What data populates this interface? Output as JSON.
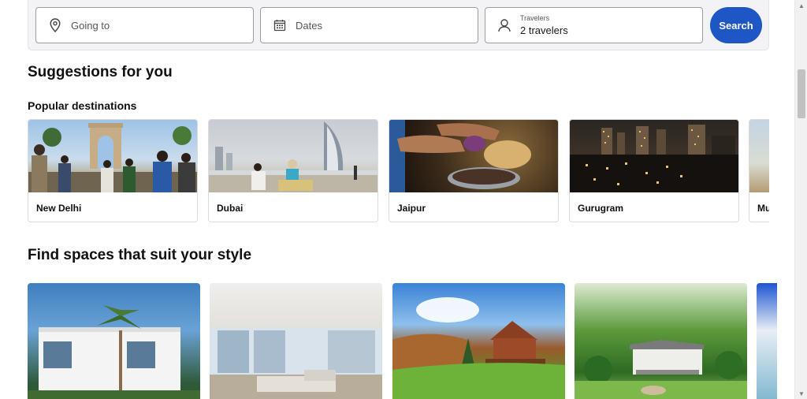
{
  "search": {
    "going_placeholder": "Going to",
    "dates_placeholder": "Dates",
    "travelers_label": "Travelers",
    "travelers_value": "2 travelers",
    "search_button": "Search",
    "accent_color": "#1e56c5"
  },
  "suggestions": {
    "title": "Suggestions for you",
    "popular_title": "Popular destinations",
    "destinations": [
      {
        "name": "New Delhi"
      },
      {
        "name": "Dubai"
      },
      {
        "name": "Jaipur"
      },
      {
        "name": "Gurugram"
      },
      {
        "name": "Mu"
      }
    ]
  },
  "styles": {
    "title": "Find spaces that suit your style"
  },
  "icons": {
    "going": "location-pin-icon",
    "dates": "calendar-icon",
    "travelers": "person-icon"
  }
}
